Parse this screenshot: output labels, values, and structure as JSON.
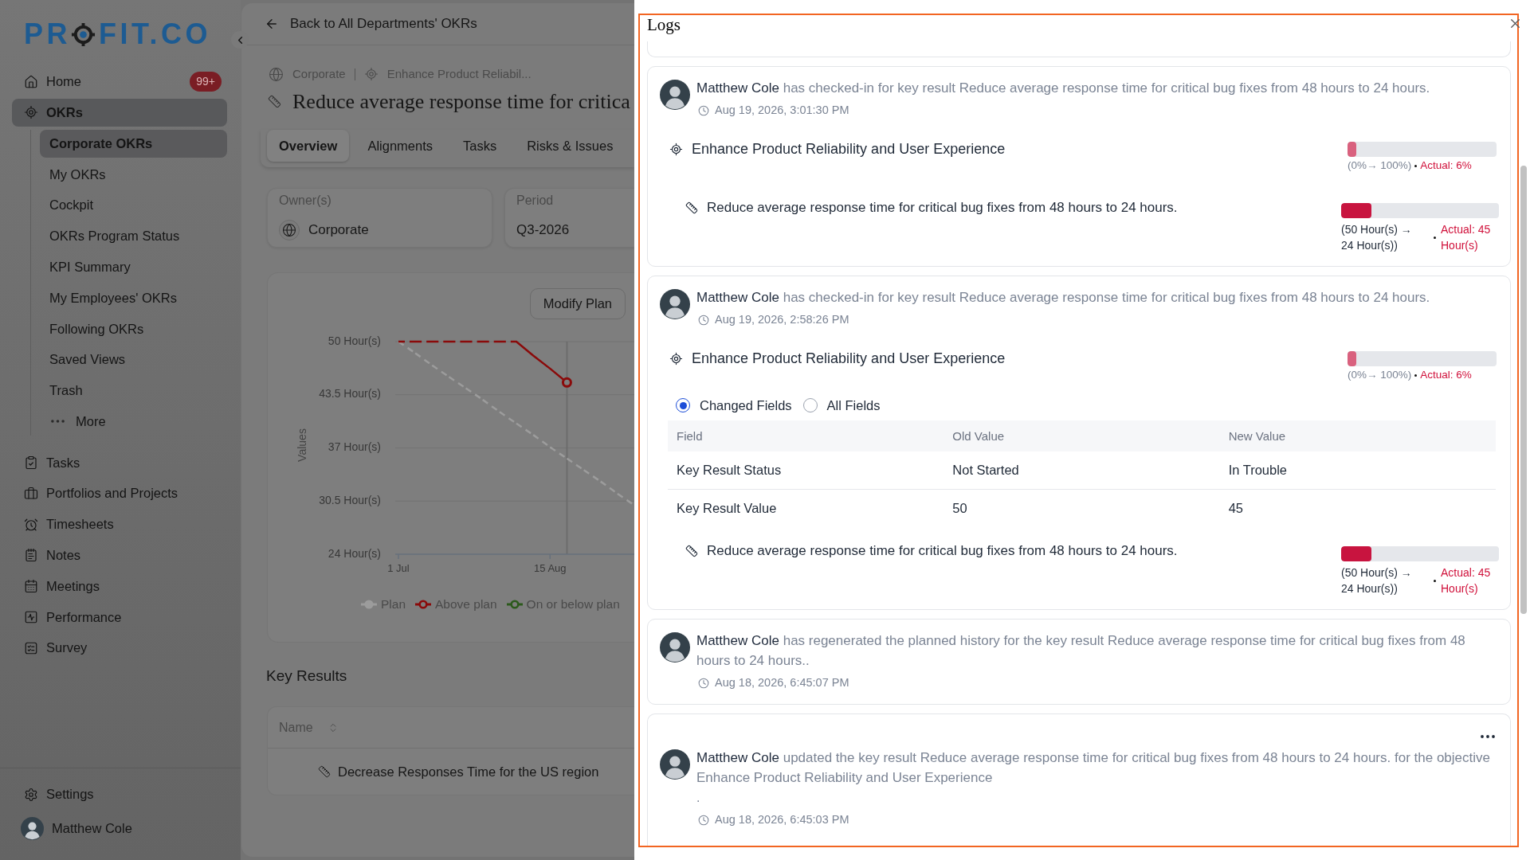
{
  "sidebar": {
    "logo": {
      "left": "PR",
      "right": "FIT.CO"
    },
    "items": [
      {
        "label": "Home",
        "badge": "99+",
        "selected": false
      },
      {
        "label": "OKRs",
        "selected": true,
        "children": [
          {
            "label": "Corporate OKRs",
            "kind": "link",
            "selected": true
          },
          {
            "label": "My OKRs",
            "kind": "link",
            "selected": false
          },
          {
            "label": "Cockpit",
            "kind": "link",
            "selected": false
          },
          {
            "label": "OKRs Program Status",
            "kind": "link",
            "selected": false
          },
          {
            "label": "KPI Summary",
            "kind": "link",
            "selected": false
          },
          {
            "label": "My Employees' OKRs",
            "kind": "link",
            "selected": false
          },
          {
            "label": "Following OKRs",
            "kind": "link",
            "selected": false
          },
          {
            "label": "Saved Views",
            "kind": "link",
            "selected": false
          },
          {
            "label": "Trash",
            "kind": "link",
            "selected": false
          },
          {
            "label": "More",
            "kind": "more",
            "selected": false
          }
        ]
      },
      {
        "label": "Tasks",
        "selected": false
      },
      {
        "label": "Portfolios and Projects",
        "selected": false
      },
      {
        "label": "Timesheets",
        "selected": false
      },
      {
        "label": "Notes",
        "selected": false
      },
      {
        "label": "Meetings",
        "selected": false
      },
      {
        "label": "Performance",
        "selected": false
      },
      {
        "label": "Survey",
        "selected": false
      }
    ],
    "settings": {
      "label": "Settings"
    },
    "user": {
      "name": "Matthew Cole"
    }
  },
  "main": {
    "back_link": "Back to All Departments' OKRs",
    "breadcrumb": [
      {
        "label": "Corporate"
      },
      {
        "label": "Enhance Product Reliabil..."
      }
    ],
    "title": "Reduce average response time for critica",
    "tabs": [
      {
        "label": "Overview",
        "selected": true
      },
      {
        "label": "Alignments",
        "selected": false
      },
      {
        "label": "Tasks",
        "selected": false
      },
      {
        "label": "Risks & Issues",
        "selected": false
      }
    ],
    "owner": {
      "label": "Owner(s)",
      "value": "Corporate"
    },
    "period": {
      "label": "Period",
      "value": "Q3-2026"
    },
    "plan_button": "Modify Plan",
    "chart_data": {
      "type": "line",
      "ylabel": "Values",
      "grid": true,
      "categories": [
        "1 Jul",
        null,
        null,
        null,
        null,
        null,
        null,
        null,
        null,
        "15 Aug",
        null,
        null,
        null,
        null,
        null
      ],
      "series": [
        {
          "name": "Plan",
          "color": "#9c9c9c",
          "line_style": "dashed",
          "values": [
            50,
            48.6,
            47.1,
            45.7,
            44.3,
            42.9,
            41.4,
            40,
            38.6,
            37.1,
            35.7,
            34.3,
            32.9,
            31.4,
            30
          ]
        },
        {
          "name": "Above plan",
          "color": "#8a0a0a",
          "line_style": "dashed",
          "values": [
            50,
            50,
            50,
            50,
            50,
            50,
            50,
            50,
            48.3,
            46.7,
            45,
            null,
            null,
            null,
            null
          ]
        },
        {
          "name": "On or below plan",
          "color": "#2c5a1c",
          "values": [
            null,
            null,
            null,
            null,
            null,
            null,
            null,
            null,
            null,
            null,
            null,
            null,
            null,
            null,
            null
          ]
        }
      ],
      "ylim": [
        24,
        50
      ],
      "yticks": [
        {
          "value": 50,
          "label": "50 Hour(s)"
        },
        {
          "value": 43.5,
          "label": "43.5 Hour(s)"
        },
        {
          "value": 37,
          "label": "37 Hour(s)"
        },
        {
          "value": 30.5,
          "label": "30.5 Hour(s)"
        },
        {
          "value": 24,
          "label": "24 Hour(s)"
        }
      ]
    },
    "key_results": {
      "title": "Key Results",
      "columns": [
        {
          "label": "Name"
        }
      ],
      "rows": [
        {
          "name": "Decrease Responses Time for the US region"
        }
      ]
    }
  },
  "logs": {
    "title": "Logs",
    "entries": [
      {
        "actor": "Matthew Cole",
        "message": "has checked-in for key result Reduce average response time for critical bug fixes from 48 hours to 24 hours.",
        "time": "Aug 19, 2026, 3:01:30 PM",
        "menu": false,
        "objective": {
          "title": "Enhance Product Reliability and User Experience",
          "level": 0.06,
          "range": "(0%→ 100%)",
          "actual": "Actual: 6%"
        },
        "key_result": {
          "title": "Reduce average response time for critical bug fixes from 48 hours to 24 hours.",
          "level": 0.19,
          "range": "(50 Hour(s) → 24 Hour(s))",
          "actual": "Actual: 45 Hour(s)"
        }
      },
      {
        "actor": "Matthew Cole",
        "message": "has checked-in for key result Reduce average response time for critical bug fixes from 48 hours to 24 hours.",
        "time": "Aug 19, 2026, 2:58:26 PM",
        "menu": false,
        "objective": {
          "title": "Enhance Product Reliability and User Experience",
          "level": 0.06,
          "range": "(0%→ 100%)",
          "actual": "Actual: 6%"
        },
        "changes": {
          "options": [
            {
              "label": "Changed Fields",
              "selected": true
            },
            {
              "label": "All Fields",
              "selected": false
            }
          ],
          "columns": [
            "Field",
            "Old Value",
            "New Value"
          ],
          "rows": [
            [
              "Key Result Status",
              "Not Started",
              "In Trouble"
            ],
            [
              "Key Result Value",
              "50",
              "45"
            ]
          ]
        },
        "key_result": {
          "title": "Reduce average response time for critical bug fixes from 48 hours to 24 hours.",
          "level": 0.19,
          "range": "(50 Hour(s) → 24 Hour(s))",
          "actual": "Actual: 45 Hour(s)"
        }
      },
      {
        "actor": "Matthew Cole",
        "message": "has regenerated the planned history for the key result Reduce average response time for critical bug fixes from 48 hours to 24 hours..",
        "time": "Aug 18, 2026, 6:45:07 PM",
        "menu": false
      },
      {
        "actor": "Matthew Cole",
        "message": "updated the key result Reduce average response time for critical bug fixes from 48 hours to 24 hours. for the objective Enhance Product Reliability and User Experience",
        "note": ".",
        "time": "Aug 18, 2026, 6:45:03 PM",
        "menu": true
      }
    ]
  }
}
